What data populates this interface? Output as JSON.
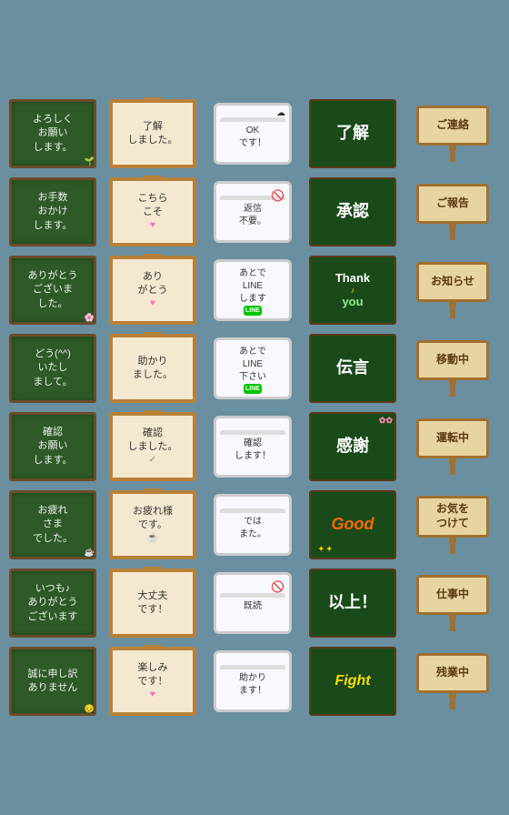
{
  "stickers": [
    {
      "id": 1,
      "type": "chalkboard",
      "text": "よろしく\nお願い\nします。",
      "deco": "🌱"
    },
    {
      "id": 2,
      "type": "wood-frame",
      "text": "了解\nしました。"
    },
    {
      "id": 3,
      "type": "phone-style",
      "text": "OK\nです！",
      "icon": "☁"
    },
    {
      "id": 4,
      "type": "green-board",
      "text": "了解",
      "color": "#00cc00"
    },
    {
      "id": 5,
      "type": "wood-sign",
      "text": "ご連絡"
    },
    {
      "id": 6,
      "type": "chalkboard",
      "text": "お手数\nおかけ\nします。"
    },
    {
      "id": 7,
      "type": "wood-frame",
      "text": "こちら\nこそ",
      "heart": true
    },
    {
      "id": 8,
      "type": "phone-style",
      "text": "返信\n不要。",
      "icon": "🚫"
    },
    {
      "id": 9,
      "type": "green-board",
      "text": "承認"
    },
    {
      "id": 10,
      "type": "wood-sign",
      "text": "ご報告"
    },
    {
      "id": 11,
      "type": "chalkboard",
      "text": "ありがとう\nございま\nした。",
      "deco": "🌸"
    },
    {
      "id": 12,
      "type": "wood-frame",
      "text": "あり\nがとう",
      "heart": true
    },
    {
      "id": 13,
      "type": "phone-style",
      "text": "あとで\nLINE\nします",
      "lineicon": true
    },
    {
      "id": 14,
      "type": "green-board",
      "text": "Thank\n♪you",
      "special": "thankyou"
    },
    {
      "id": 15,
      "type": "wood-sign",
      "text": "お知らせ"
    },
    {
      "id": 16,
      "type": "chalkboard",
      "text": "どう(^^)\nいたし\nまして。"
    },
    {
      "id": 17,
      "type": "wood-frame",
      "text": "助かり\nました。"
    },
    {
      "id": 18,
      "type": "phone-style",
      "text": "あとで\nLINE\n下さい",
      "lineicon": true
    },
    {
      "id": 19,
      "type": "green-board",
      "text": "伝言"
    },
    {
      "id": 20,
      "type": "wood-sign",
      "text": "移動中"
    },
    {
      "id": 21,
      "type": "chalkboard",
      "text": "確認\nお願い\nします。"
    },
    {
      "id": 22,
      "type": "wood-frame",
      "text": "確認\nしました。",
      "check": true
    },
    {
      "id": 23,
      "type": "phone-style",
      "text": "確認\nします！"
    },
    {
      "id": 24,
      "type": "green-board",
      "text": "感謝",
      "flowers": true
    },
    {
      "id": 25,
      "type": "wood-sign",
      "text": "運転中"
    },
    {
      "id": 26,
      "type": "chalkboard",
      "text": "お疲れ\nさま\nでした。",
      "deco": "☕"
    },
    {
      "id": 27,
      "type": "wood-frame",
      "text": "お疲れ様\nです。",
      "cup": true
    },
    {
      "id": 28,
      "type": "phone-style",
      "text": "では\nまた。"
    },
    {
      "id": 29,
      "type": "green-board",
      "text": "Good",
      "special": "good"
    },
    {
      "id": 30,
      "type": "wood-sign",
      "text": "お気を\nつけて"
    },
    {
      "id": 31,
      "type": "chalkboard",
      "text": "いつも♪\nありがとう\nございます"
    },
    {
      "id": 32,
      "type": "wood-frame",
      "text": "大丈夫\nです！"
    },
    {
      "id": 33,
      "type": "phone-style",
      "text": "既読",
      "icon": "🚫"
    },
    {
      "id": 34,
      "type": "green-board",
      "text": "以上！"
    },
    {
      "id": 35,
      "type": "wood-sign",
      "text": "仕事中"
    },
    {
      "id": 36,
      "type": "chalkboard",
      "text": "誠に申し訳\nありません",
      "deco": "😔"
    },
    {
      "id": 37,
      "type": "wood-frame",
      "text": "楽しみ\nです！",
      "heart": true
    },
    {
      "id": 38,
      "type": "phone-style",
      "text": "助かり\nます！"
    },
    {
      "id": 39,
      "type": "green-board",
      "text": "Fight",
      "special": "fight"
    },
    {
      "id": 40,
      "type": "wood-sign",
      "text": "残業中"
    }
  ]
}
